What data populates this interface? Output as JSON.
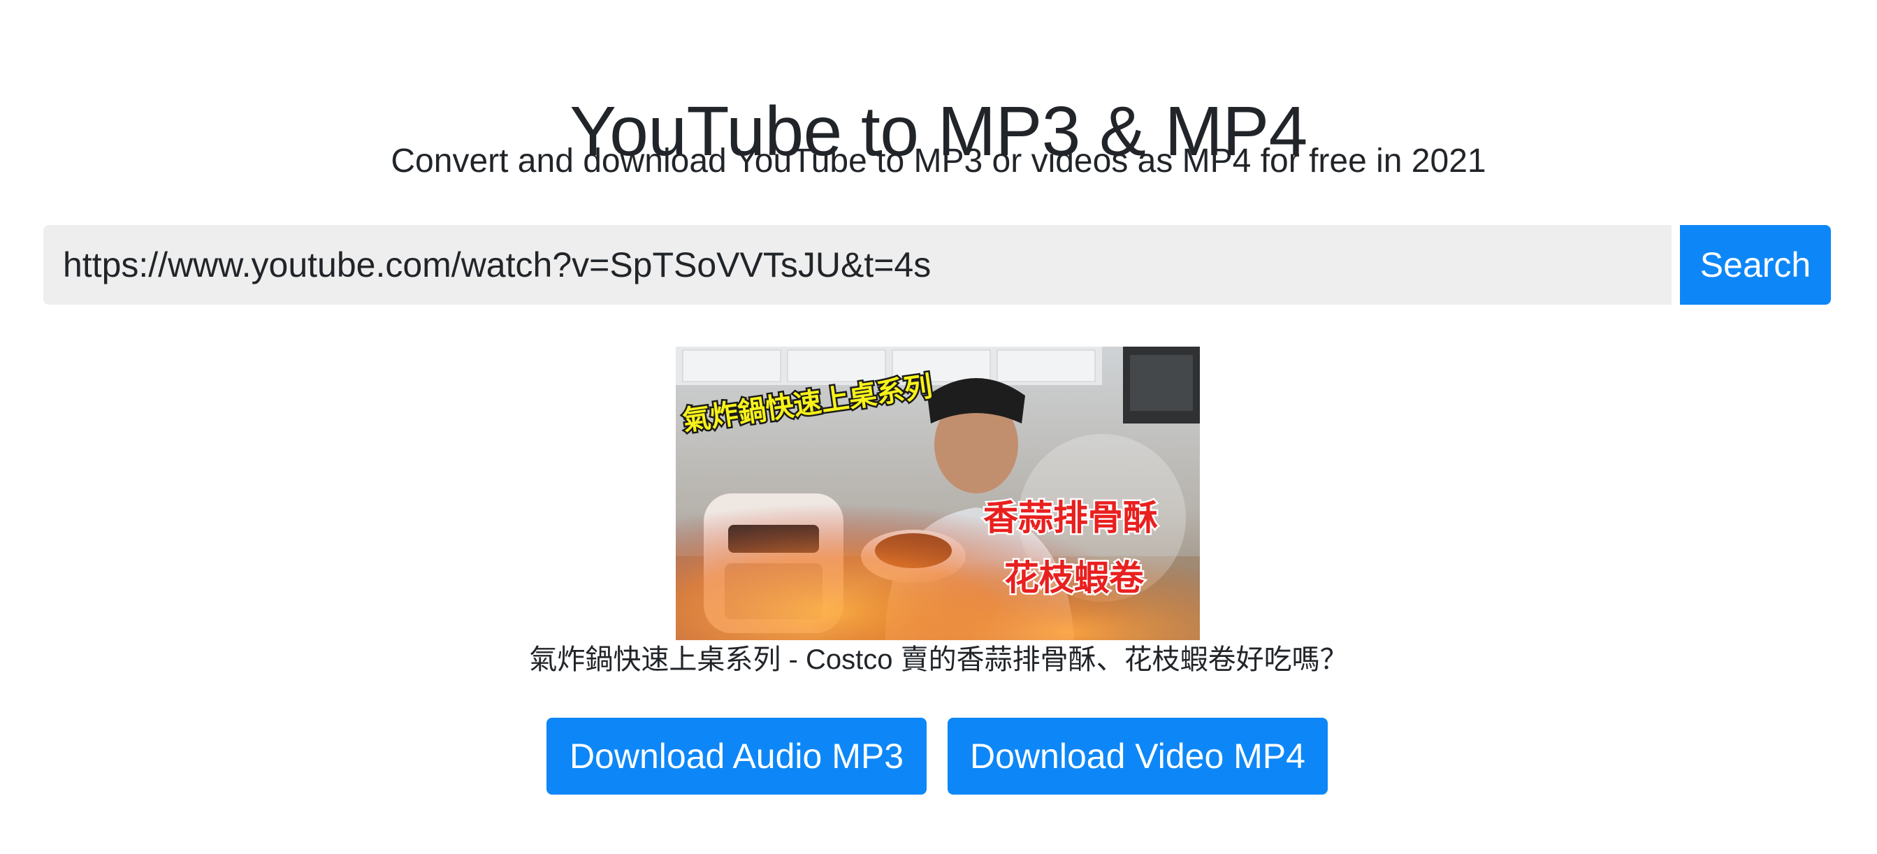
{
  "header": {
    "title": "YouTube to MP3 & MP4",
    "subtitle": "Convert and download YouTube to MP3 or videos as MP4 for free in 2021"
  },
  "search": {
    "value": "https://www.youtube.com/watch?v=SpTSoVVTsJU&t=4s",
    "button_label": "Search"
  },
  "video": {
    "thumbnail_overlay": {
      "banner": "氣炸鍋快速上桌系列",
      "line1": "香蒜排骨酥",
      "line2": "花枝蝦卷"
    },
    "title": "氣炸鍋快速上桌系列 - Costco 賣的香蒜排骨酥、花枝蝦卷好吃嗎？"
  },
  "actions": {
    "mp3_label": "Download Audio MP3",
    "mp4_label": "Download Video MP4"
  },
  "colors": {
    "accent": "#0d87f8",
    "input_bg": "#eeeeee",
    "text": "#212529"
  }
}
